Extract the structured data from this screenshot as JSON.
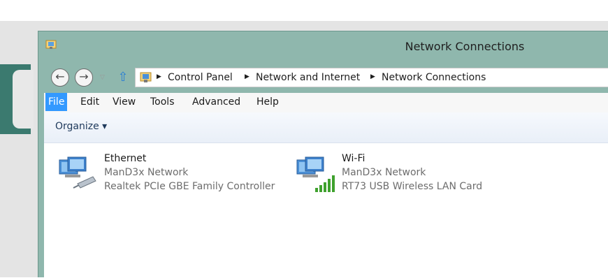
{
  "window": {
    "title": "Network Connections"
  },
  "address_bar": {
    "breadcrumbs": [
      "Control Panel",
      "Network and Internet",
      "Network Connections"
    ]
  },
  "menu": {
    "items": [
      {
        "label": "File"
      },
      {
        "label": "Edit"
      },
      {
        "label": "View"
      },
      {
        "label": "Tools"
      },
      {
        "label": "Advanced"
      },
      {
        "label": "Help"
      }
    ]
  },
  "toolbar": {
    "organize_label": "Organize ▾"
  },
  "connections": [
    {
      "name": "Ethernet",
      "network": "ManD3x Network",
      "device": "Realtek PCIe GBE Family Controller",
      "icon": "ethernet-adapter-icon"
    },
    {
      "name": "Wi-Fi",
      "network": "ManD3x Network",
      "device": "RT73 USB Wireless LAN Card",
      "icon": "wifi-adapter-icon"
    }
  ],
  "colors": {
    "titlebar": "#8fb7ad",
    "menu_active": "#3399ff",
    "signal_bars": "#3fa12e"
  }
}
